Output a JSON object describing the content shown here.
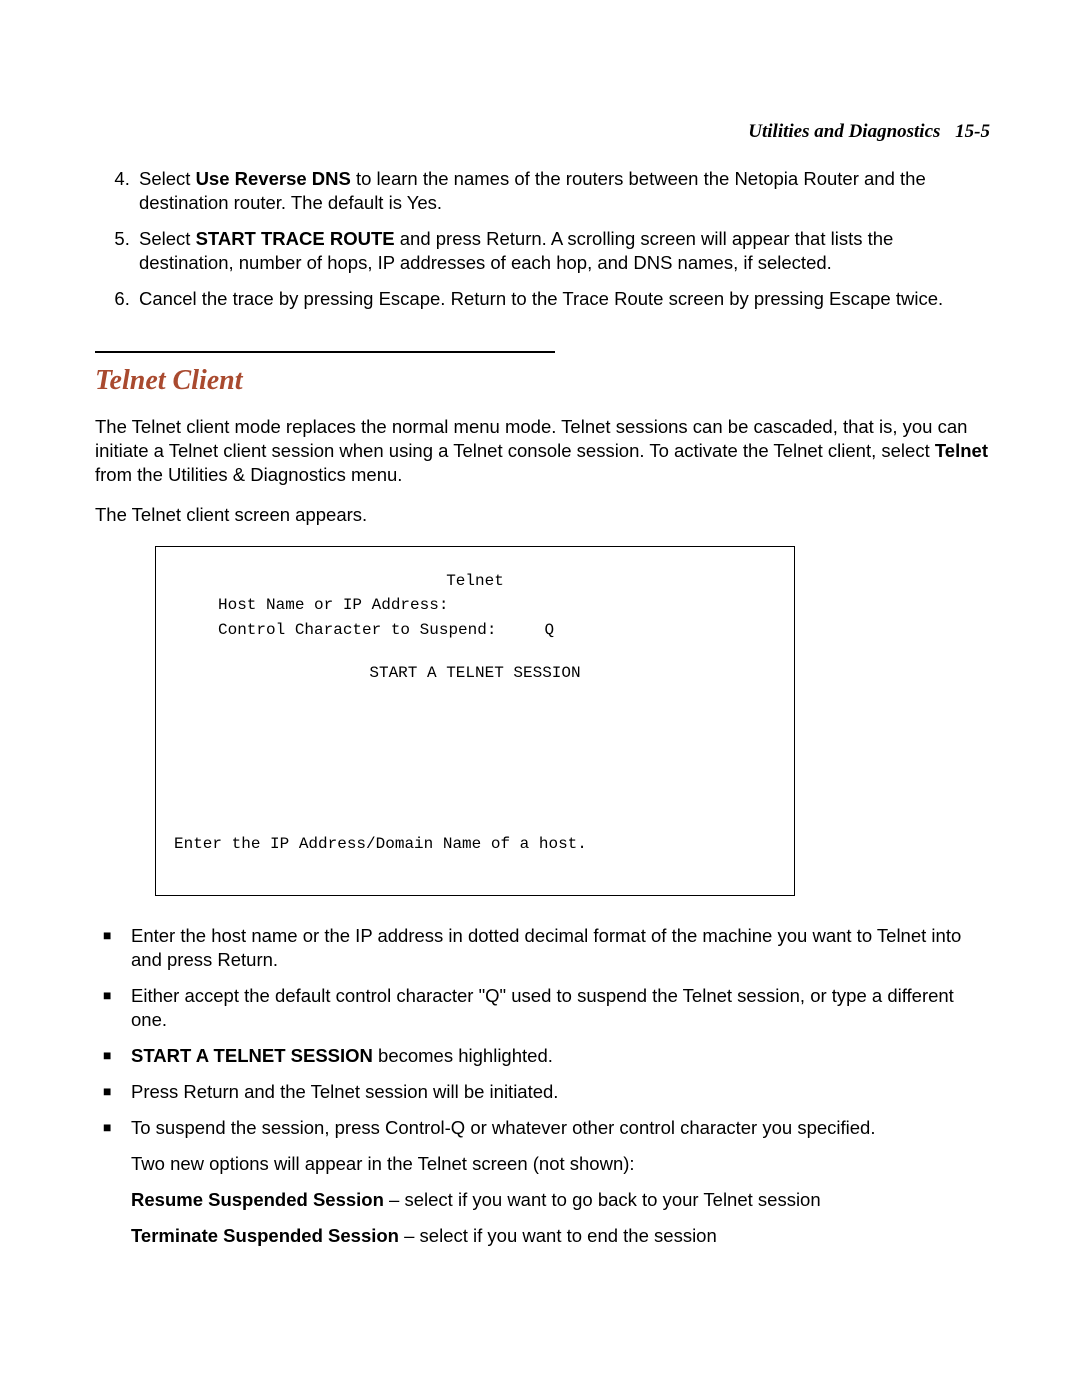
{
  "header": {
    "title": "Utilities and Diagnostics",
    "page_label": "15-5"
  },
  "steps": {
    "start": 4,
    "items": [
      {
        "prefix": "Select ",
        "bold": "Use Reverse DNS",
        "rest": " to learn the names of the routers between the Netopia Router and the destination router. The default is Yes."
      },
      {
        "prefix": "Select ",
        "bold": "START TRACE ROUTE",
        "rest": " and press Return. A scrolling screen will appear that lists the destination, number of hops, IP addresses of each hop, and DNS names, if selected."
      },
      {
        "prefix": "",
        "bold": "",
        "rest": "Cancel the trace by pressing Escape. Return to the Trace Route screen by pressing Escape twice."
      }
    ]
  },
  "section": {
    "title": "Telnet Client",
    "para1_a": "The Telnet client mode replaces the normal menu mode. Telnet sessions can be cascaded, that is, you can initiate a Telnet client session when using a Telnet console session. To activate the Telnet client, select ",
    "para1_b": "Telnet",
    "para1_c": " from the Utilities & Diagnostics menu.",
    "para2": "The Telnet client screen appears."
  },
  "screen": {
    "title": "Telnet",
    "row_host": "Host Name or IP Address:",
    "row_ctrl": "Control Character to Suspend:     Q",
    "start": "START A TELNET SESSION",
    "bottom": "Enter the IP Address/Domain Name of a host."
  },
  "bullets": [
    {
      "prefix": "",
      "bold": "",
      "rest": "Enter the host name or the IP address in dotted decimal format of the machine you want to Telnet into and press Return."
    },
    {
      "prefix": "",
      "bold": "",
      "rest": "Either accept the default control character \"Q\" used to suspend the Telnet session, or type a different one."
    },
    {
      "prefix": "",
      "bold": "START A TELNET SESSION",
      "rest": " becomes highlighted."
    },
    {
      "prefix": "",
      "bold": "",
      "rest": "Press Return and the Telnet session will be initiated."
    },
    {
      "prefix": "",
      "bold": "",
      "rest": "To suspend the session, press Control-Q or whatever other control character you specified."
    }
  ],
  "tail": {
    "line1": "Two new options will appear in the Telnet screen (not shown):",
    "resume_bold": "Resume Suspended Session",
    "resume_rest": " – select if you want to go back to your Telnet session",
    "terminate_bold": "Terminate Suspended Session",
    "terminate_rest": " – select if you want to end the session"
  }
}
